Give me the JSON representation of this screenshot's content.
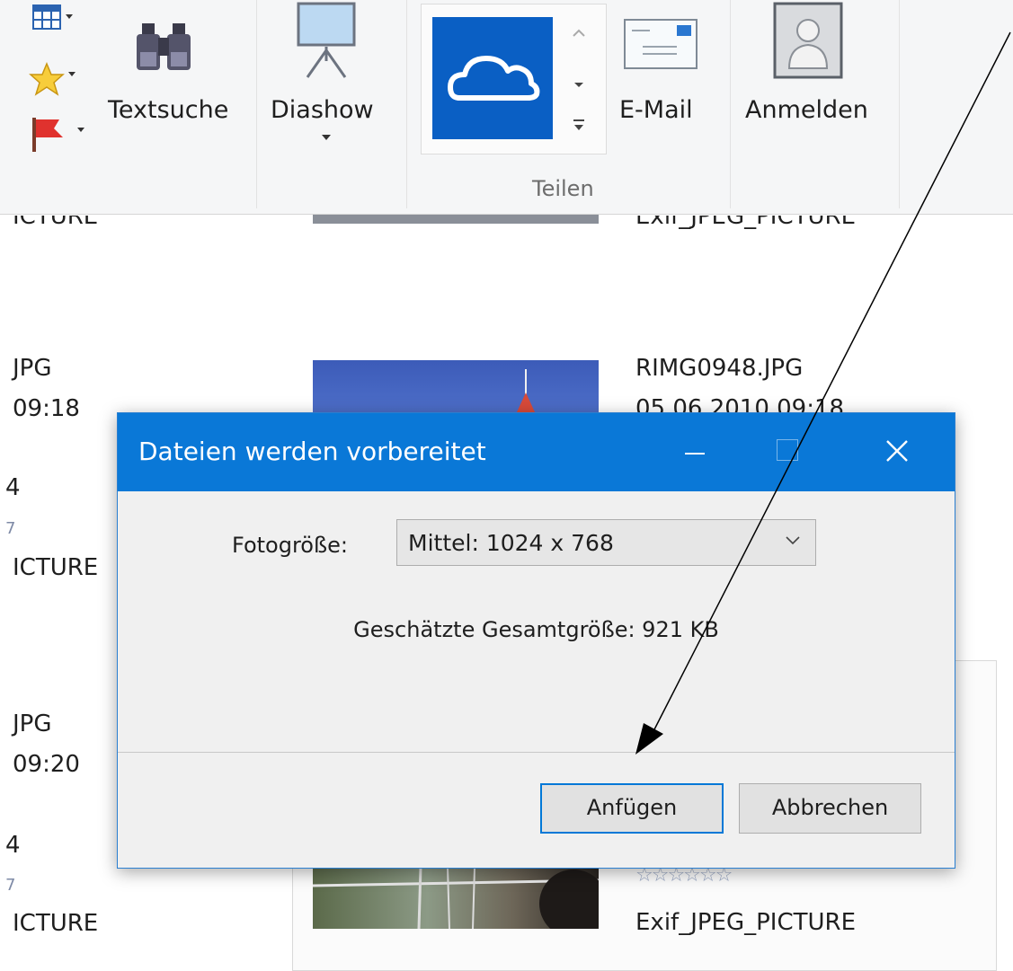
{
  "ribbon": {
    "search_label": "Textsuche",
    "slideshow_label": "Diashow",
    "email_label": "E-Mail",
    "signin_label": "Anmelden",
    "share_group_label": "Teilen"
  },
  "files": {
    "left_col": [
      {
        "name": "JPG",
        "time": "09:18",
        "rating_frag": "4",
        "stars_frag": "7",
        "tag": "ICTURE"
      },
      {
        "name": "JPG",
        "time": "09:20",
        "rating_frag": "4",
        "stars_frag": "7",
        "tag": "ICTURE"
      }
    ],
    "top_cut_left": "ICTURE",
    "top_cut_right": "Exif_JPEG_PICTURE",
    "right_item": {
      "name": "RIMG0948.JPG",
      "date": "05.06.2010 09:18"
    },
    "bottom_right": {
      "stars": "☆☆☆☆☆☆",
      "tag": "Exif_JPEG_PICTURE"
    }
  },
  "dialog": {
    "title": "Dateien werden vorbereitet",
    "photo_size_label": "Fotogröße:",
    "photo_size_value": "Mittel: 1024 x 768",
    "estimate": "Geschätzte Gesamtgröße: 921 KB",
    "attach_label": "Anfügen",
    "cancel_label": "Abbrechen"
  },
  "colors": {
    "titlebar": "#0a78d7",
    "onedrive_tile": "#0a5fc4",
    "focus_border": "#0078d7"
  }
}
